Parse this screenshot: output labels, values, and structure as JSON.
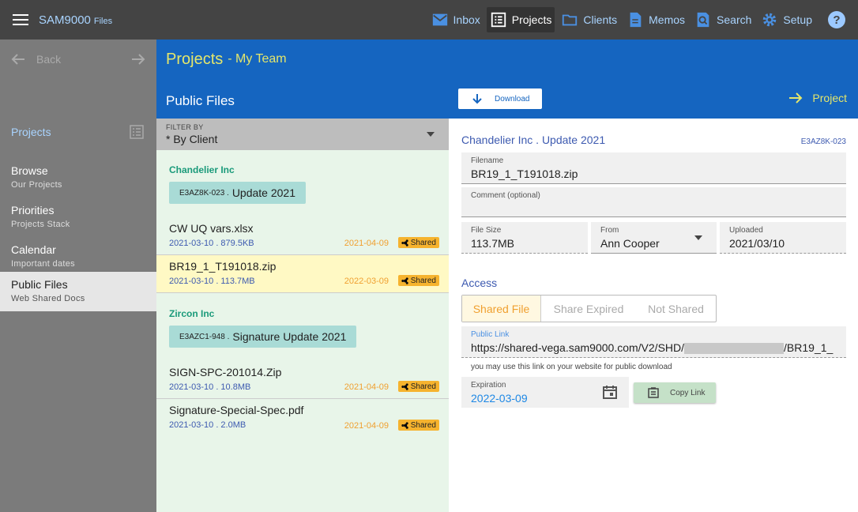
{
  "app": {
    "name": "SAM9000",
    "subtitle": "Files"
  },
  "nav": [
    {
      "label": "Inbox",
      "icon": "mail-icon"
    },
    {
      "label": "Projects",
      "icon": "list-icon",
      "active": true
    },
    {
      "label": "Clients",
      "icon": "folder-icon"
    },
    {
      "label": "Memos",
      "icon": "document-icon"
    },
    {
      "label": "Search",
      "icon": "search-icon"
    },
    {
      "label": "Setup",
      "icon": "gear-icon"
    }
  ],
  "help_label": "?",
  "sidebar": {
    "back_label": "Back",
    "section_label": "Projects",
    "items": [
      {
        "title": "Browse",
        "subtitle": "Our Projects"
      },
      {
        "title": "Priorities",
        "subtitle": "Projects Stack"
      },
      {
        "title": "Calendar",
        "subtitle": "Important dates"
      },
      {
        "title": "Public Files",
        "subtitle": "Web Shared Docs",
        "active": true
      }
    ]
  },
  "header": {
    "title": "Projects",
    "subtitle": "- My Team"
  },
  "list": {
    "title": "Public Files",
    "filter_label": "FILTER BY",
    "filter_value": "* By Client",
    "groups": [
      {
        "client": "Chandelier Inc",
        "chip_code": "E3AZ8K-023 .",
        "chip_label": "Update 2021",
        "files": [
          {
            "name": "CW UQ vars.xlsx",
            "meta": "2021-03-10 . 879.5KB",
            "date": "2021-04-09",
            "badge": "Shared"
          },
          {
            "name": "BR19_1_T191018.zip",
            "meta": "2021-03-10 . 113.7MB",
            "date": "2022-03-09",
            "badge": "Shared"
          }
        ]
      },
      {
        "client": "Zircon Inc",
        "chip_code": "E3AZC1-948 .",
        "chip_label": "Signature Update 2021",
        "files": [
          {
            "name": "SIGN-SPC-201014.Zip",
            "meta": "2021-03-10 . 10.8MB",
            "date": "2021-04-09",
            "badge": "Shared"
          },
          {
            "name": "Signature-Special-Spec.pdf",
            "meta": "2021-03-10 . 2.0MB",
            "date": "2021-04-09",
            "badge": "Shared"
          }
        ]
      }
    ]
  },
  "detail": {
    "download_label": "Download",
    "project_link_label": "Project",
    "title": "Chandelier Inc . Update 2021",
    "code": "E3AZ8K-023",
    "filename_label": "Filename",
    "filename_value": "BR19_1_T191018.zip",
    "comment_label": "Comment (optional)",
    "filesize_label": "File Size",
    "filesize_value": "113.7MB",
    "from_label": "From",
    "from_value": "Ann Cooper",
    "uploaded_label": "Uploaded",
    "uploaded_value": "2021/03/10",
    "access_label": "Access",
    "access_options": [
      "Shared File",
      "Share Expired",
      "Not Shared"
    ],
    "public_link_label": "Public Link",
    "public_link_prefix": "https://shared-vega.sam9000.com/V2/SHD/",
    "public_link_suffix": "/BR19_1_",
    "hint": "you may use this link on your website for public download",
    "expiration_label": "Expiration",
    "expiration_value": "2022-03-09",
    "copy_label": "Copy Link"
  },
  "colors": {
    "primary": "#1565c0",
    "accent_yellow": "#e4e66b",
    "shared_badge": "#f6b32e",
    "link_blue": "#3d5ab0"
  }
}
